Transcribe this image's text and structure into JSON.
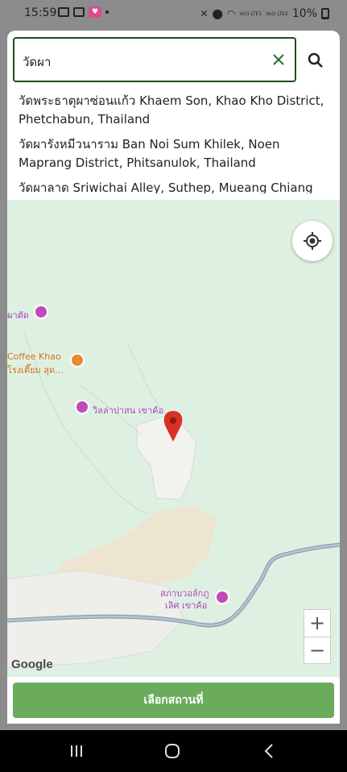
{
  "status_bar": {
    "time": "15:59",
    "battery": "10%",
    "signal_label_1": "Vo)) LTE1",
    "signal_label_2": "Vo)) LTE2"
  },
  "search": {
    "value": "วัดผา"
  },
  "suggestions": [
    "วัดพระธาตุผาซ่อนแก้ว Khaem Son, Khao Kho District, Phetchabun, Thailand",
    "วัดผารังหมีวนาราม Ban Noi Sum Khilek, Noen Maprang District, Phitsanulok, Thailand",
    "วัดผาลาด Sriwichai Alley, Suthep, Mueang Chiang Mai"
  ],
  "map": {
    "pois": [
      "ผาตัด",
      "Coffee Khao",
      "โรงเตี๊ยม สุด...",
      "วิลล่าปาสน เขาค้อ",
      "สภาบวอล์กภู",
      "เลิศ เขาค้อ"
    ],
    "google_logo": "Google"
  },
  "select_button": "เลือกสถานที่",
  "colors": {
    "accent_green": "#6aac5c",
    "border_green": "#1f4d1f",
    "map_bg": "#def0e2",
    "pin_red": "#d93025"
  }
}
